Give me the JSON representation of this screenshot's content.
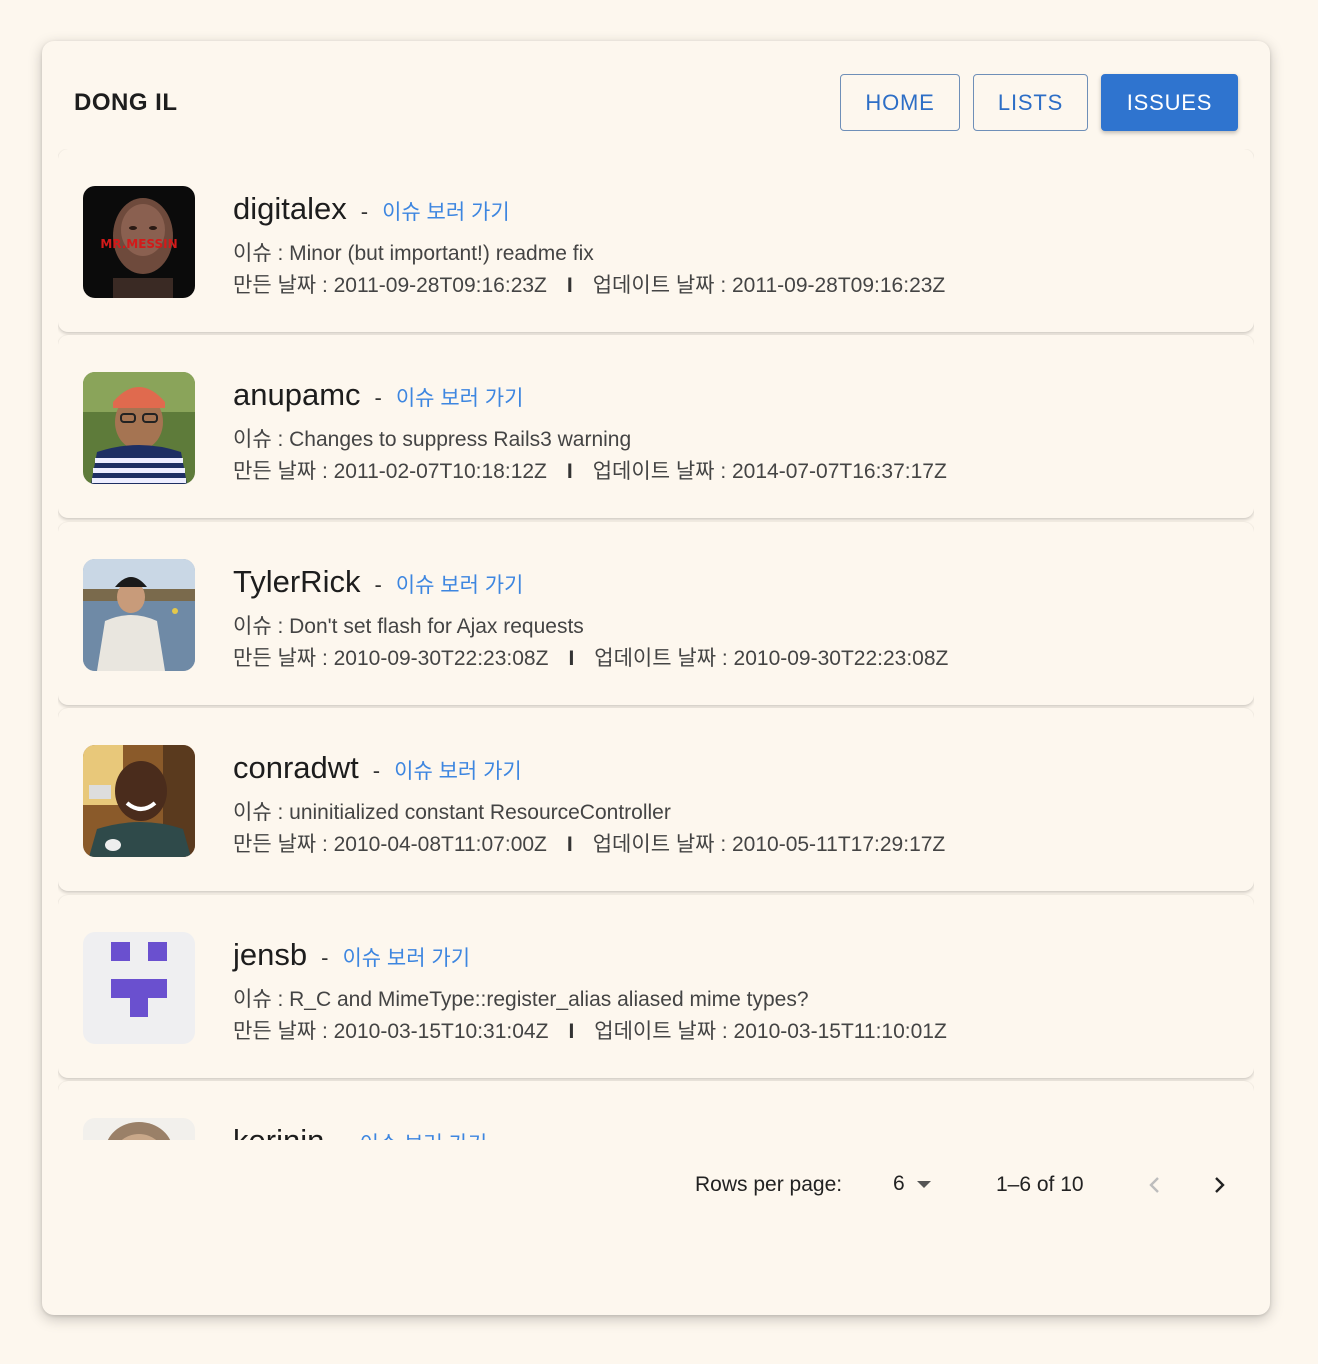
{
  "header": {
    "brand": "DONG IL",
    "nav": {
      "home": "HOME",
      "lists": "LISTS",
      "issues": "ISSUES"
    },
    "active_tab": "issues"
  },
  "issues": [
    {
      "user": "digitalex",
      "link": "이슈 보러 가기",
      "issue": "이슈 : Minor (but important!) readme fix",
      "created": "만든 날짜 : 2011-09-28T09:16:23Z",
      "updated": "업데이트 날짜 : 2011-09-28T09:16:23Z",
      "avatar_text": "MR.MESSIN"
    },
    {
      "user": "anupamc",
      "link": "이슈 보러 가기",
      "issue": "이슈 : Changes to suppress Rails3 warning",
      "created": "만든 날짜 : 2011-02-07T10:18:12Z",
      "updated": "업데이트 날짜 : 2014-07-07T16:37:17Z"
    },
    {
      "user": "TylerRick",
      "link": "이슈 보러 가기",
      "issue": "이슈 : Don't set flash for Ajax requests",
      "created": "만든 날짜 : 2010-09-30T22:23:08Z",
      "updated": "업데이트 날짜 : 2010-09-30T22:23:08Z"
    },
    {
      "user": "conradwt",
      "link": "이슈 보러 가기",
      "issue": "이슈 : uninitialized constant ResourceController",
      "created": "만든 날짜 : 2010-04-08T11:07:00Z",
      "updated": "업데이트 날짜 : 2010-05-11T17:29:17Z"
    },
    {
      "user": "jensb",
      "link": "이슈 보러 가기",
      "issue": "이슈 : R_C and MimeType::register_alias aliased mime types?",
      "created": "만든 날짜 : 2010-03-15T10:31:04Z",
      "updated": "업데이트 날짜 : 2010-03-15T11:10:01Z"
    },
    {
      "user": "kerinin",
      "link": "이슈 보러 가기"
    }
  ],
  "separator": "I",
  "pagination": {
    "rows_label": "Rows per page:",
    "rows_value": "6",
    "range": "1–6 of 10"
  },
  "colors": {
    "accent": "#2f74cf",
    "link": "#3d86e0",
    "background": "#fdf7ee"
  }
}
